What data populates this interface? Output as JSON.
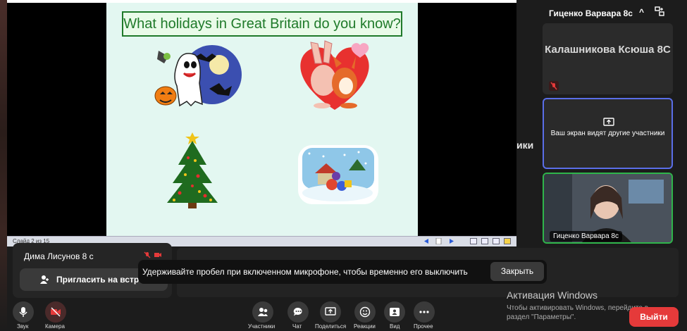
{
  "shared_screen": {
    "slide_title": "What holidays in Great Britain do you know?",
    "status_left": "Слайд 2 из 15"
  },
  "right_panel": {
    "header_name": "Гиценко Варвара 8с",
    "header_chevron": "^",
    "tile1_name": "Калашникова Ксюша 8С",
    "tile2_text": "Ваш экран видят другие участники",
    "tile3_name": "Гиценко Варвара 8с",
    "side_fragment": "ики"
  },
  "participants": {
    "row_name": "Дима Лисунов 8 с",
    "invite_label": "Пригласить на встре"
  },
  "toast": {
    "message": "Удерживайте пробел при включенном микрофоне, чтобы временно его выключить",
    "close_label": "Закрыть"
  },
  "windows_activation": {
    "title": "Активация Windows",
    "line1": "Чтобы активировать Windows, перейдите в",
    "line2": "раздел \"Параметры\"."
  },
  "toolbar": {
    "sound": "Звук",
    "camera": "Камера",
    "participants": "Участники",
    "chat": "Чат",
    "share": "Поделиться",
    "reactions": "Реакции",
    "view": "Вид",
    "more": "Прочее",
    "leave": "Выйти"
  },
  "colors": {
    "slide_bg": "#e3f7f1",
    "title_green": "#1f7a2a",
    "active_border_blue": "#5a6ee8",
    "speaker_border_green": "#2fb54a",
    "leave_red": "#e53a3a"
  }
}
